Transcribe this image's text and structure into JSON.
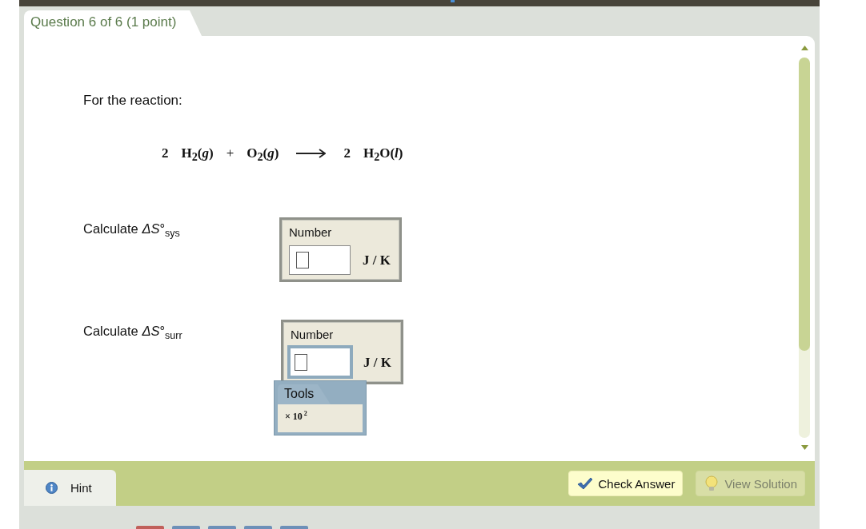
{
  "question_tab": {
    "title": "Question 6 of 6 (1 point)"
  },
  "intro": "For the reaction:",
  "equation": {
    "reactants": [
      {
        "coefficient": "2",
        "formula": "H$_{2}$(*g*)"
      },
      {
        "formula": "O$_{2}$(*g*)"
      }
    ],
    "plus": "+",
    "products": [
      {
        "coefficient": "2",
        "formula": "H$_{2}$O(*l*)"
      }
    ]
  },
  "parts": [
    {
      "prompt": "Calculate *ΔS*°$_{sys}$",
      "answer": {
        "label": "Number",
        "unit": "J / K",
        "focused": false
      }
    },
    {
      "prompt": "Calculate *ΔS*°$_{surr}$",
      "answer": {
        "label": "Number",
        "unit": "J / K",
        "focused": true,
        "tools": {
          "title": "Tools",
          "items": [
            "× 10$^{2}$"
          ]
        }
      }
    }
  ],
  "footer": {
    "hint": {
      "label": "Hint"
    },
    "actions": [
      {
        "kind": "check",
        "label": "Check Answer",
        "disabled": false
      },
      {
        "kind": "solution",
        "label": "View Solution",
        "disabled": true
      }
    ]
  },
  "bottom_tabs": [
    {
      "color": "#c0605a"
    },
    {
      "color": "#6d90b8"
    },
    {
      "color": "#6d90b8"
    },
    {
      "color": "#6d90b8"
    },
    {
      "color": "#6d90b8"
    }
  ]
}
